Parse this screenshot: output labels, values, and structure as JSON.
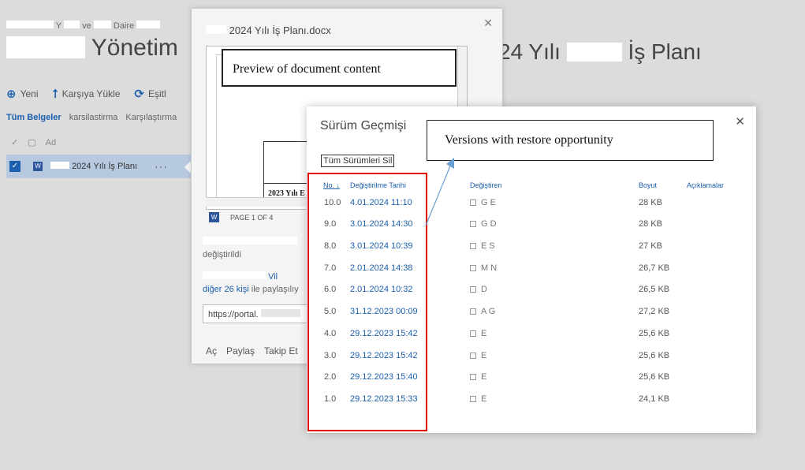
{
  "breadcrumb": {
    "part1": "Y",
    "part2": "ve",
    "part3": "Daire"
  },
  "page": {
    "title": "Yönetim",
    "title_right": "24 Yılı",
    "title_right_end": "İş Planı"
  },
  "toolbar": {
    "new": "Yeni",
    "upload": "Karşıya Yükle",
    "sync": "Eşitl"
  },
  "views": {
    "all": "Tüm Belgeler",
    "v2": "karsilastirma",
    "v3": "Karşılaştırma"
  },
  "list_header": {
    "name": "Ad"
  },
  "file_row": {
    "name": "2024 Yılı İş Planı"
  },
  "callout": {
    "title": "2024 Yılı İş Planı.docx",
    "preview_annotation": "Preview of document content",
    "preview_table_text": "2023 Yılı E",
    "page_indicator": "PAGE 1 OF 4",
    "changed_text": "değiştirildi",
    "shared_prefix": "diğer 26 kişi",
    "shared_suffix": "ile paylaşılıy",
    "shared_link_prefix": "Vil",
    "url": "https://portal.",
    "actions": [
      "Aç",
      "Paylaş",
      "Takip Et"
    ]
  },
  "version_history": {
    "title": "Sürüm Geçmişi",
    "delete_all": "Tüm Sürümleri Sil",
    "annotation": "Versions with restore opportunity",
    "headers": {
      "no": "No.",
      "date": "Değiştirilme Tarihi",
      "by": "Değiştiren",
      "size": "Boyut",
      "comments": "Açıklamalar"
    },
    "rows": [
      {
        "no": "10.0",
        "date": "4.01.2024 11:10",
        "by": "G E",
        "size": "28 KB"
      },
      {
        "no": "9.0",
        "date": "3.01.2024 14:30",
        "by": "G D",
        "size": "28 KB"
      },
      {
        "no": "8.0",
        "date": "3.01.2024 10:39",
        "by": "E S",
        "size": "27 KB"
      },
      {
        "no": "7.0",
        "date": "2.01.2024 14:38",
        "by": "M N",
        "size": "26,7 KB"
      },
      {
        "no": "6.0",
        "date": "2.01.2024 10:32",
        "by": "D",
        "size": "26,5 KB"
      },
      {
        "no": "5.0",
        "date": "31.12.2023 00:09",
        "by": "A G",
        "size": "27,2 KB"
      },
      {
        "no": "4.0",
        "date": "29.12.2023 15:42",
        "by": "E",
        "size": "25,6 KB"
      },
      {
        "no": "3.0",
        "date": "29.12.2023 15:42",
        "by": "E",
        "size": "25,6 KB"
      },
      {
        "no": "2.0",
        "date": "29.12.2023 15:40",
        "by": "E",
        "size": "25,6 KB"
      },
      {
        "no": "1.0",
        "date": "29.12.2023 15:33",
        "by": "E",
        "size": "24,1 KB"
      }
    ]
  }
}
